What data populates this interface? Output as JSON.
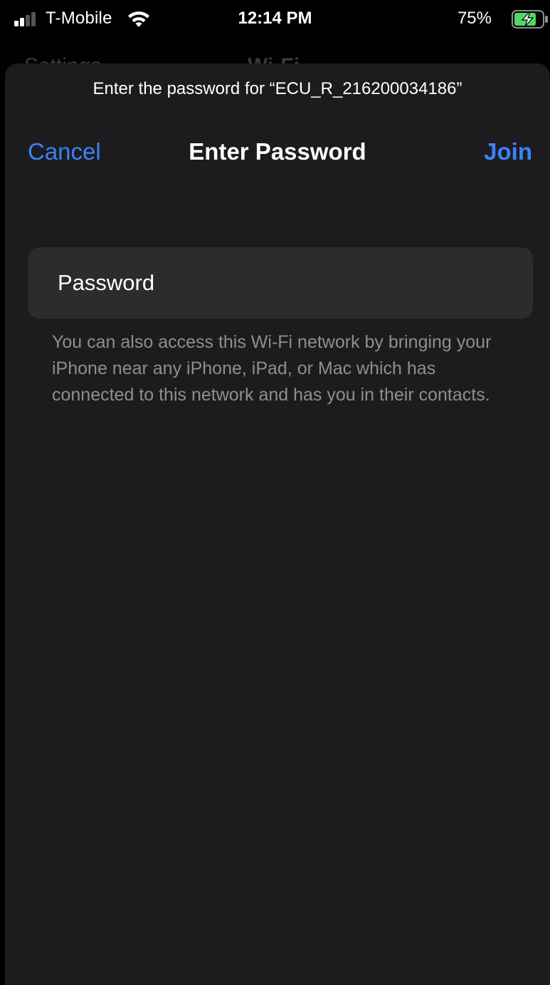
{
  "status_bar": {
    "carrier": "T-Mobile",
    "time": "12:14 PM",
    "battery_percent": "75%",
    "signal_bars_filled": 2,
    "signal_bars_total": 4,
    "battery_charging": true,
    "icons": [
      "signal-icon",
      "wifi-icon",
      "battery-charging-icon"
    ]
  },
  "background_nav": {
    "back_label": "Settings",
    "title": "Wi-Fi"
  },
  "sheet": {
    "prompt": "Enter the password for “ECU_R_216200034186”",
    "nav": {
      "cancel_label": "Cancel",
      "title": "Enter Password",
      "join_label": "Join"
    },
    "password_field": {
      "placeholder": "Password",
      "value": ""
    },
    "helper_text": "You can also access this Wi-Fi network by bringing your iPhone near any iPhone, iPad, or Mac which has connected to this network and has you in their contacts."
  },
  "colors": {
    "accent": "#3b82f6",
    "sheet_background": "#1c1c1e",
    "field_background": "#2c2c2e",
    "secondary_text": "#8e8e93",
    "battery_fill": "#4cd964"
  }
}
